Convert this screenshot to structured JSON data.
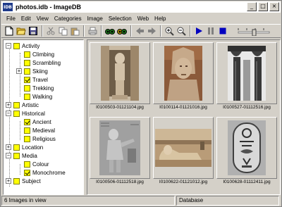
{
  "window": {
    "title": "photos.idb - ImageDB",
    "app_icon_text": "IDB"
  },
  "title_buttons": {
    "minimize": "_",
    "maximize": "□",
    "close": "×"
  },
  "menu": [
    "File",
    "Edit",
    "View",
    "Categories",
    "Image",
    "Selection",
    "Web",
    "Help"
  ],
  "toolbar": {
    "icons": [
      "new-icon",
      "open-icon",
      "save-icon",
      "cut-icon",
      "copy-icon",
      "paste-icon",
      "print-icon",
      "binoculars-icon",
      "binoculars-find-icon",
      "back-icon",
      "forward-icon",
      "zoom-in-icon",
      "zoom-out-icon",
      "play-icon",
      "pause-icon",
      "stop-icon"
    ]
  },
  "tree": [
    {
      "label": "Activity",
      "expander": "−",
      "checked": false
    },
    {
      "label": "Climbing",
      "checked": false
    },
    {
      "label": "Scrambling",
      "checked": false
    },
    {
      "label": "Skiing",
      "expander": "+",
      "checked": false
    },
    {
      "label": "Travel",
      "checked": true
    },
    {
      "label": "Trekking",
      "checked": false
    },
    {
      "label": "Walking",
      "checked": false
    },
    {
      "label": "Artistic",
      "expander": "+",
      "checked": false
    },
    {
      "label": "Historical",
      "expander": "−",
      "checked": false
    },
    {
      "label": "Ancient",
      "checked": true
    },
    {
      "label": "Medieval",
      "checked": false
    },
    {
      "label": "Religious",
      "checked": false
    },
    {
      "label": "Location",
      "expander": "+",
      "checked": false
    },
    {
      "label": "Media",
      "expander": "−",
      "checked": false
    },
    {
      "label": "Colour",
      "checked": false
    },
    {
      "label": "Monochrome",
      "checked": true
    },
    {
      "label": "Subject",
      "expander": "+",
      "checked": false
    }
  ],
  "thumbnails": [
    {
      "caption": "I0100503-01121104.jpg"
    },
    {
      "caption": "I0100114-01121016.jpg"
    },
    {
      "caption": "I0100527-01112516.jpg"
    },
    {
      "caption": "I0100506-01112518.jpg"
    },
    {
      "caption": "I0100622-01121012.jpg"
    },
    {
      "caption": "I0100628-01112411.jpg"
    }
  ],
  "status": {
    "count": "6 Images in view",
    "section": "Database"
  }
}
